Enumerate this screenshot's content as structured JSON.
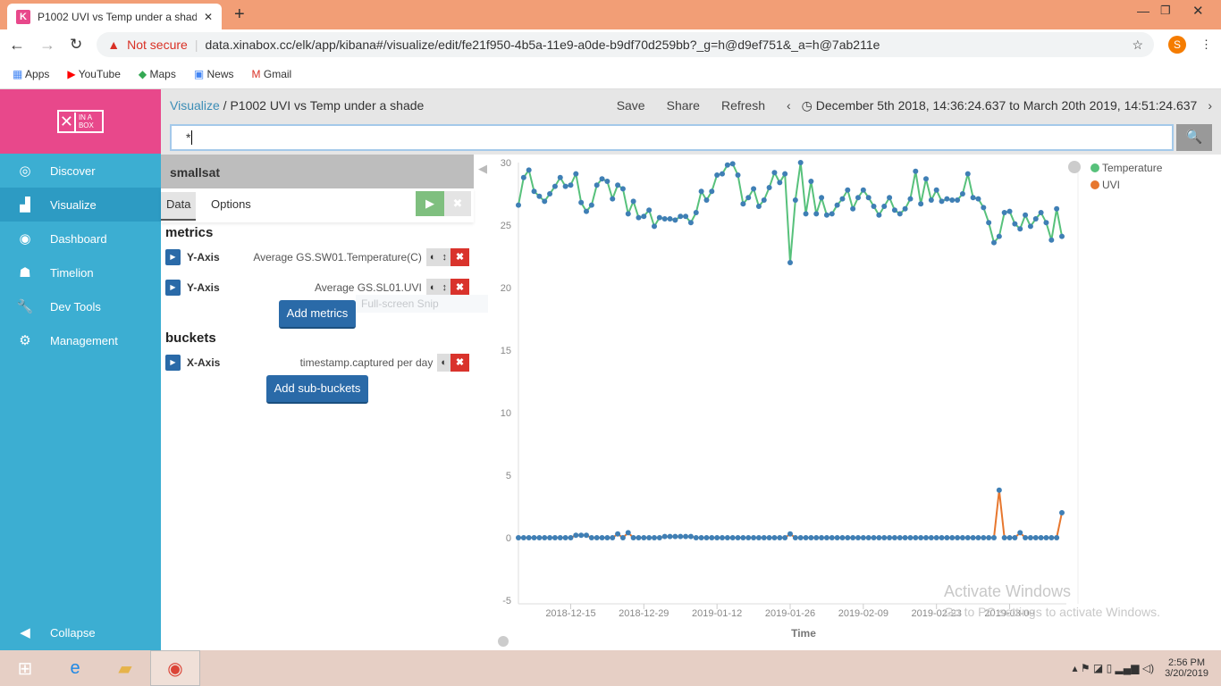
{
  "browser": {
    "tab_title": "P1002 UVI vs Temp under a shad",
    "security": "Not secure",
    "url": "data.xinabox.cc/elk/app/kibana#/visualize/edit/fe21f950-4b5a-11e9-a0de-b9df70d259bb?_g=h@d9ef751&_a=h@7ab211e",
    "avatar": "S",
    "bookmarks": [
      "Apps",
      "YouTube",
      "Maps",
      "News",
      "Gmail"
    ]
  },
  "sidebar": {
    "logo": "IN A BOX",
    "items": [
      {
        "label": "Discover",
        "icon": "compass-icon"
      },
      {
        "label": "Visualize",
        "icon": "bar-chart-icon"
      },
      {
        "label": "Dashboard",
        "icon": "dashboard-icon"
      },
      {
        "label": "Timelion",
        "icon": "timelion-icon"
      },
      {
        "label": "Dev Tools",
        "icon": "wrench-icon"
      },
      {
        "label": "Management",
        "icon": "gear-icon"
      }
    ],
    "collapse": "Collapse"
  },
  "header": {
    "breadcrumb_root": "Visualize",
    "title": "P1002 UVI vs Temp under a shade",
    "save": "Save",
    "share": "Share",
    "refresh": "Refresh",
    "time_range": "December 5th 2018, 14:36:24.637 to March 20th 2019, 14:51:24.637"
  },
  "query": {
    "value": "*"
  },
  "editor": {
    "index": "smallsat",
    "tabs": [
      "Data",
      "Options"
    ],
    "metrics_heading": "metrics",
    "metrics": [
      {
        "axis": "Y-Axis",
        "desc": "Average GS.SW01.Temperature(C)"
      },
      {
        "axis": "Y-Axis",
        "desc": "Average GS.SL01.UVI"
      }
    ],
    "add_metrics": "Add metrics",
    "buckets_heading": "buckets",
    "buckets": [
      {
        "axis": "X-Axis",
        "desc": "timestamp.captured per day"
      }
    ],
    "add_buckets": "Add sub-buckets"
  },
  "overlay": {
    "snip": "Full-screen Snip",
    "watermark1": "Activate Windows",
    "watermark2": "Go to PC settings to activate Windows."
  },
  "taskbar": {
    "time": "2:56 PM",
    "date": "3/20/2019"
  },
  "chart_data": {
    "type": "line",
    "start_date": "2018-12-05",
    "xlabel": "Time",
    "ylabel": "",
    "ylim": [
      -5,
      30
    ],
    "yticks": [
      -5,
      0,
      5,
      10,
      15,
      20,
      25,
      30
    ],
    "xticks": [
      "2018-12-15",
      "2018-12-29",
      "2019-01-12",
      "2019-01-26",
      "2019-02-09",
      "2019-02-23",
      "2019-03-09"
    ],
    "legend_position": "top-right",
    "point_color": "#3f7fb5",
    "series": [
      {
        "name": "Temperature",
        "color": "#57c17b",
        "values": [
          26.6,
          28.8,
          29.4,
          27.7,
          27.3,
          26.9,
          27.5,
          28.1,
          28.8,
          28.1,
          28.2,
          29.1,
          26.8,
          26.1,
          26.6,
          28.2,
          28.7,
          28.5,
          27.1,
          28.2,
          27.9,
          25.9,
          26.9,
          25.6,
          25.7,
          26.2,
          24.9,
          25.6,
          25.5,
          25.5,
          25.4,
          25.7,
          25.7,
          25.2,
          26.0,
          27.7,
          27.0,
          27.7,
          29.0,
          29.1,
          29.8,
          29.9,
          29.0,
          26.7,
          27.2,
          27.9,
          26.5,
          27.0,
          28.0,
          29.2,
          28.4,
          29.1,
          22.0,
          27.0,
          30.0,
          25.9,
          28.5,
          25.9,
          27.2,
          25.8,
          25.9,
          26.6,
          27.1,
          27.8,
          26.3,
          27.2,
          27.8,
          27.2,
          26.5,
          25.8,
          26.5,
          27.2,
          26.2,
          25.9,
          26.3,
          27.1,
          29.3,
          26.7,
          28.7,
          27.0,
          27.8,
          26.9,
          27.1,
          27.0,
          27.0,
          27.5,
          29.1,
          27.2,
          27.1,
          26.4,
          25.2,
          23.6,
          24.1,
          26.0,
          26.1,
          25.1,
          24.7,
          25.8,
          24.9,
          25.5,
          26.0,
          25.2,
          23.8,
          26.3,
          24.1
        ]
      },
      {
        "name": "UVI",
        "color": "#e7772e",
        "values": [
          0,
          0,
          0,
          0,
          0,
          0,
          0,
          0,
          0,
          0,
          0,
          0.2,
          0.2,
          0.2,
          0,
          0,
          0,
          0,
          0,
          0.3,
          0,
          0.4,
          0,
          0,
          0,
          0,
          0,
          0,
          0.1,
          0.1,
          0.1,
          0.1,
          0.1,
          0.1,
          0,
          0,
          0,
          0,
          0,
          0,
          0,
          0,
          0,
          0,
          0,
          0,
          0,
          0,
          0,
          0,
          0,
          0,
          0.3,
          0,
          0,
          0,
          0,
          0,
          0,
          0,
          0,
          0,
          0,
          0,
          0,
          0,
          0,
          0,
          0,
          0,
          0,
          0,
          0,
          0,
          0,
          0,
          0,
          0,
          0,
          0,
          0,
          0,
          0,
          0,
          0,
          0,
          0,
          0,
          0,
          0,
          0,
          0,
          3.8,
          0,
          0,
          0,
          0.4,
          0,
          0,
          0,
          0,
          0,
          0,
          0,
          2.0
        ]
      }
    ]
  }
}
